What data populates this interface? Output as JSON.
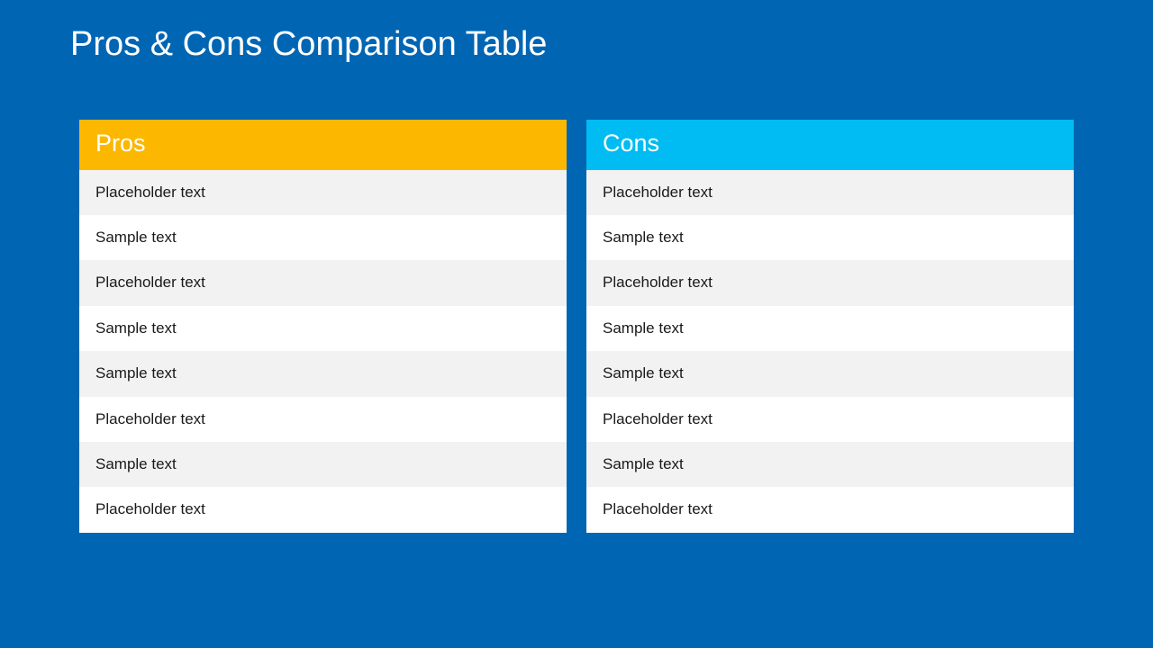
{
  "title": "Pros & Cons Comparison Table",
  "pros": {
    "header": "Pros",
    "rows": [
      "Placeholder text",
      "Sample text",
      "Placeholder text",
      "Sample text",
      "Sample text",
      "Placeholder text",
      "Sample text",
      "Placeholder text"
    ]
  },
  "cons": {
    "header": "Cons",
    "rows": [
      "Placeholder text",
      "Sample text",
      "Placeholder text",
      "Sample text",
      "Sample text",
      "Placeholder text",
      "Sample text",
      "Placeholder text"
    ]
  },
  "colors": {
    "background": "#0065b3",
    "pros_header": "#fcb800",
    "cons_header": "#00bcf2",
    "row_alt": "#f2f2f2"
  },
  "chart_data": {
    "type": "table",
    "title": "Pros & Cons Comparison Table",
    "columns": [
      "Pros",
      "Cons"
    ],
    "rows": [
      [
        "Placeholder text",
        "Placeholder text"
      ],
      [
        "Sample text",
        "Sample text"
      ],
      [
        "Placeholder text",
        "Placeholder text"
      ],
      [
        "Sample text",
        "Sample text"
      ],
      [
        "Sample text",
        "Sample text"
      ],
      [
        "Placeholder text",
        "Placeholder text"
      ],
      [
        "Sample text",
        "Sample text"
      ],
      [
        "Placeholder text",
        "Placeholder text"
      ]
    ]
  }
}
